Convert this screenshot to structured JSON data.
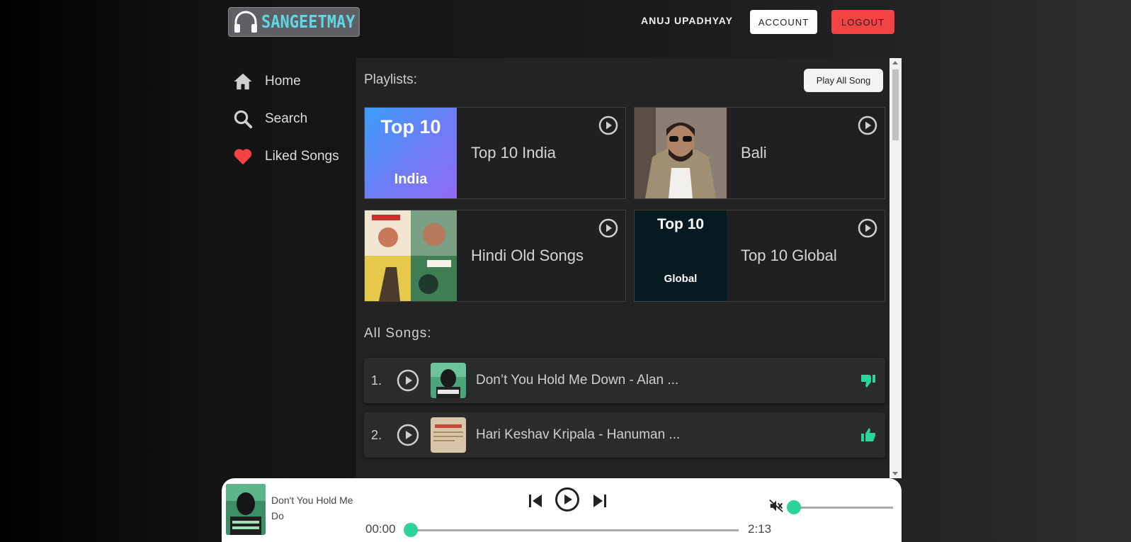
{
  "header": {
    "logo_text": "SANGEETMAY",
    "username": "ANUJ UPADHYAY",
    "account_label": "ACCOUNT",
    "logout_label": "LOGOUT"
  },
  "sidebar": {
    "items": [
      {
        "label": "Home",
        "icon": "home-icon"
      },
      {
        "label": "Search",
        "icon": "search-icon"
      },
      {
        "label": "Liked Songs",
        "icon": "heart-icon"
      }
    ]
  },
  "main": {
    "playlists_title": "Playlists:",
    "play_all_label": "Play All Song",
    "playlists": [
      {
        "name": "Top 10 India",
        "cover_line1": "Top 10",
        "cover_line2": "India"
      },
      {
        "name": "Bali"
      },
      {
        "name": "Hindi Old Songs"
      },
      {
        "name": "Top 10 Global",
        "cover_line1": "Top 10",
        "cover_line2": "Global"
      }
    ],
    "all_songs_title": "All Songs:",
    "songs": [
      {
        "number": "1.",
        "title": "Don’t You Hold Me Down - Alan ...",
        "liked": false
      },
      {
        "number": "2.",
        "title": "Hari Keshav Kripala - Hanuman ...",
        "liked": true
      }
    ]
  },
  "player": {
    "title": "Don't You Hold Me Do",
    "current_time": "00:00",
    "duration": "2:13",
    "progress": 0,
    "volume": 0,
    "muted": true
  },
  "colors": {
    "accent": "#2bd49a",
    "logout": "#f24444",
    "logo": "#5fd7e6"
  }
}
